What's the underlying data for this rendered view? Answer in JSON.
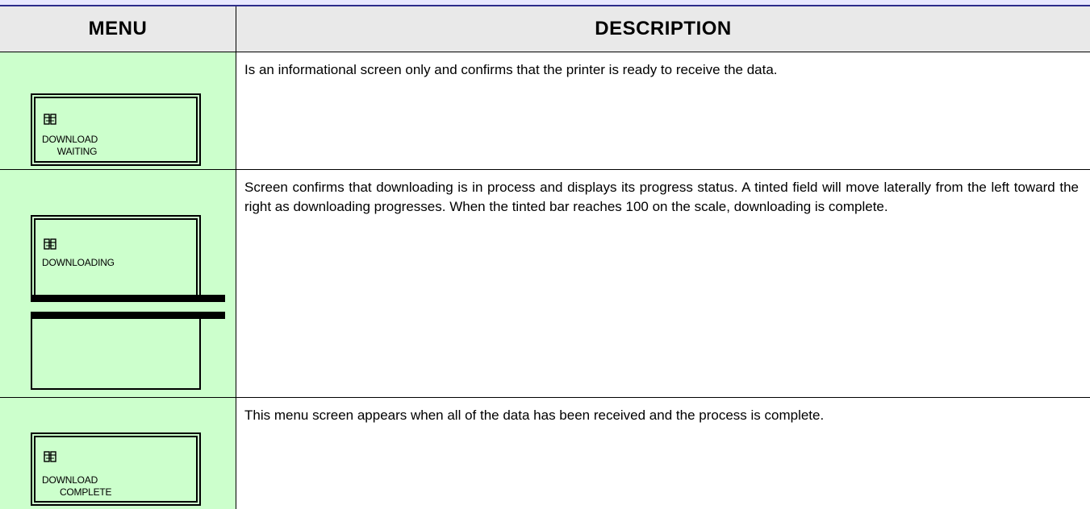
{
  "header": {
    "menu_label": "MENU",
    "description_label": "DESCRIPTION"
  },
  "rows": [
    {
      "lcd_icon": "printer-icon",
      "lcd_line1": "DOWNLOAD",
      "lcd_line2": "      WAITING",
      "description": "Is an informational screen only and confirms that the printer is ready to receive the data."
    },
    {
      "lcd_icon": "printer-icon",
      "lcd_line1": "DOWNLOADING",
      "lcd_line2": "",
      "description": "Screen confirms that downloading is in process and displays its progress status. A tinted field will move laterally from the left toward the right as downloading progresses. When the tinted bar reaches 100 on the scale, downloading is complete."
    },
    {
      "lcd_icon": "printer-icon",
      "lcd_line1": "DOWNLOAD",
      "lcd_line2": "       COMPLETE",
      "description": "This menu screen appears when all of the data has been received and the process is complete."
    }
  ],
  "colors": {
    "menu_cell_bg": "#ccffcc",
    "header_bg": "#e9e9e9",
    "top_rule": "#2c2c8a"
  }
}
